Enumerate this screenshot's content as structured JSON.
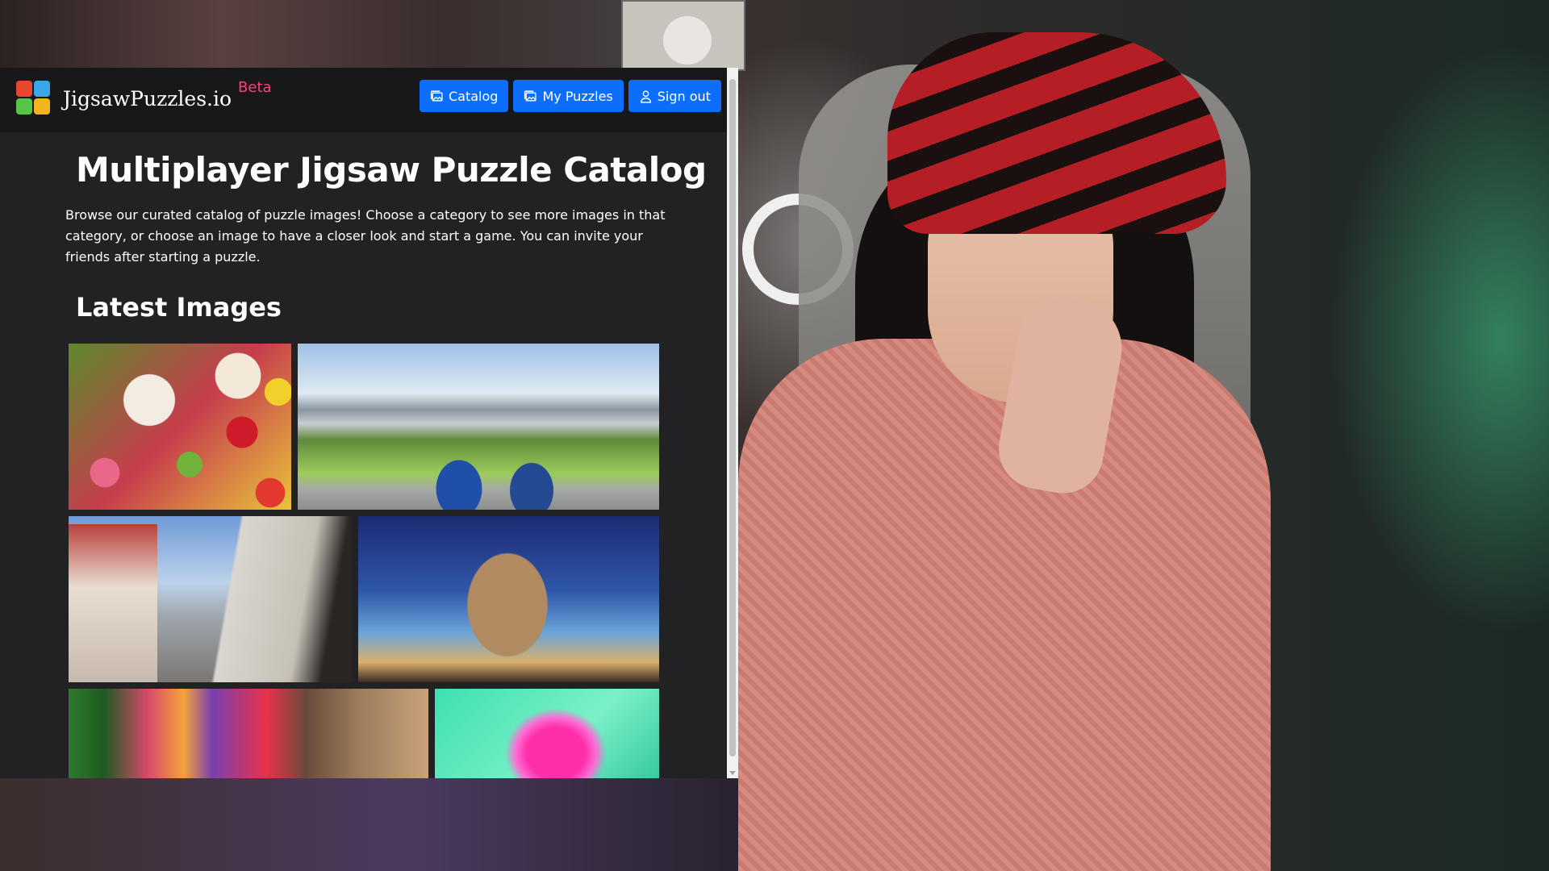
{
  "navbar": {
    "brand_name": "JigsawPuzzles.io",
    "beta_label": "Beta",
    "buttons": {
      "catalog": "Catalog",
      "my_puzzles": "My Puzzles",
      "sign_out": "Sign out"
    },
    "button_color": "#0d6efd",
    "beta_color": "#ff3d7f"
  },
  "page": {
    "title": "Multiplayer Jigsaw Puzzle Catalog",
    "intro": "Browse our curated catalog of puzzle images! Choose a category to see more images in that category, or choose an image to have a closer look and start a game. You can invite your friends after starting a puzzle.",
    "section_title": "Latest Images"
  },
  "icons": {
    "catalog": "images-icon",
    "my_puzzles": "images-icon",
    "sign_out": "person-icon"
  }
}
